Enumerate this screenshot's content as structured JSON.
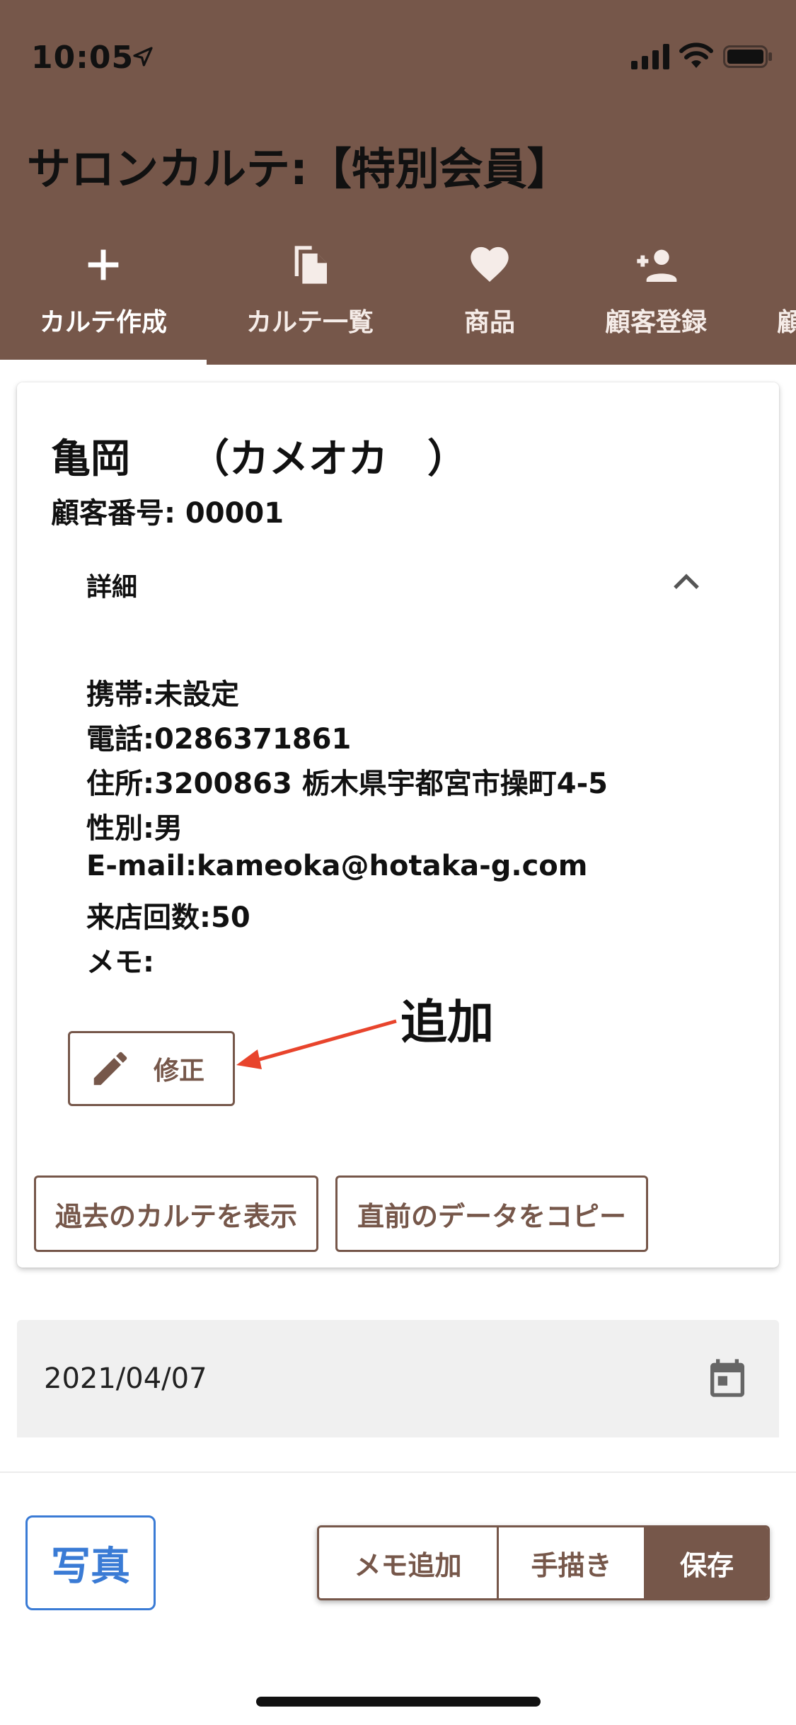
{
  "status_bar": {
    "time": "10:05"
  },
  "header": {
    "title": "サロンカルテ:【特別会員】",
    "tabs": [
      {
        "label": "カルテ作成",
        "icon": "plus-icon",
        "active": true
      },
      {
        "label": "カルテ一覧",
        "icon": "copy-file-icon"
      },
      {
        "label": "商品",
        "icon": "heart-icon"
      },
      {
        "label": "顧客登録",
        "icon": "add-person-icon"
      },
      {
        "label": "顧"
      }
    ]
  },
  "customer": {
    "name": "亀岡　　（カメオカ　）",
    "number": "顧客番号: 00001",
    "details_label": "詳細",
    "details": [
      "携帯:未設定",
      "電話:0286371861",
      "住所:3200863 栃木県宇都宮市操町4-5",
      "性別:男",
      "E-mail:kameoka@hotaka-g.com",
      "来店回数:50",
      "メモ:"
    ],
    "edit_label": "修正",
    "annotation": "追加"
  },
  "actions": {
    "past_karte": "過去のカルテを表示",
    "copy_prev": "直前のデータをコピー"
  },
  "date_field": {
    "value": "2021/04/07"
  },
  "bottom": {
    "photo": "写真",
    "memo_add": "メモ追加",
    "draw": "手描き",
    "save": "保存"
  },
  "colors": {
    "brand": "#76574a",
    "accent_blue": "#3a7bd5",
    "annotation_arrow": "#e8442c"
  }
}
